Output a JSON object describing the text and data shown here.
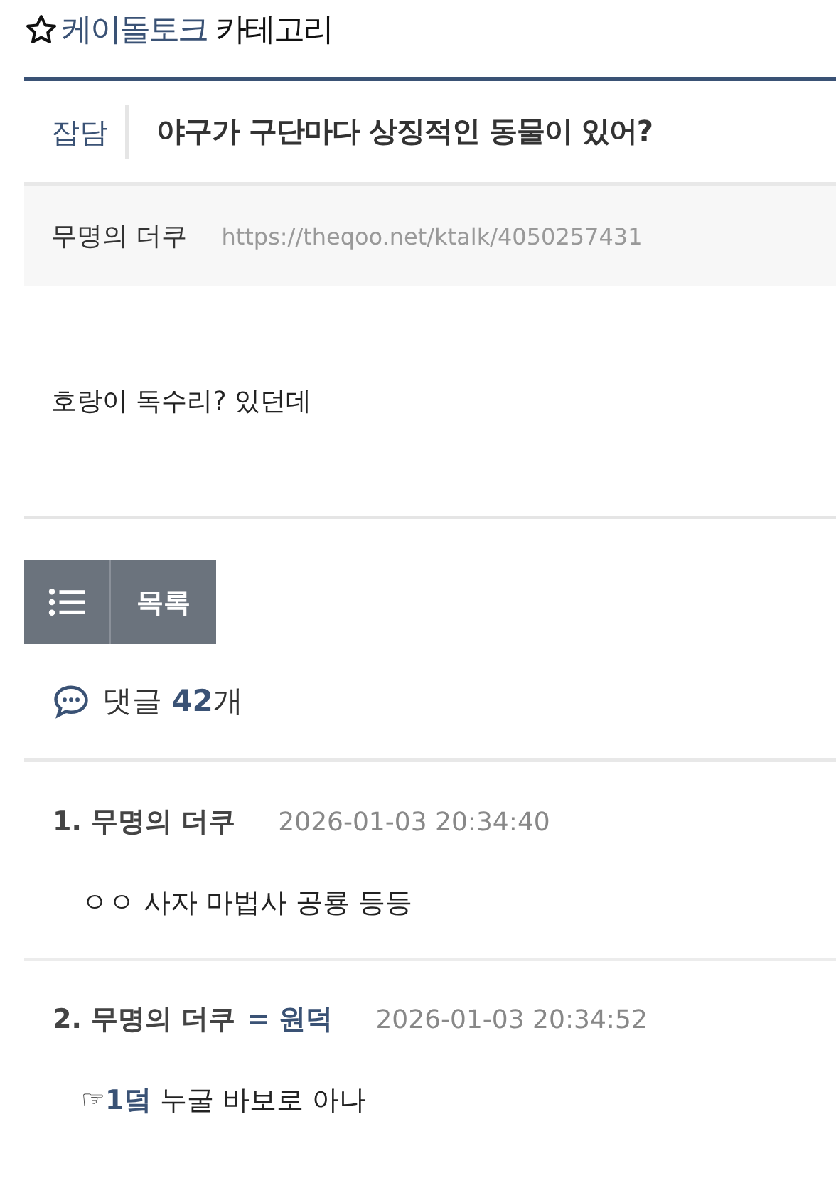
{
  "board": {
    "name": "케이돌토크",
    "suffix": "카테고리",
    "favorited": false
  },
  "post": {
    "category": "잡담",
    "title": "야구가 구단마다 상징적인 동물이 있어?",
    "author": "무명의 더쿠",
    "url": "https://theqoo.net/ktalk/4050257431",
    "body": "호랑이 독수리? 있던데"
  },
  "list_button": {
    "label": "목록"
  },
  "comments_header": {
    "label": "댓글",
    "count": "42",
    "unit": "개"
  },
  "comments": [
    {
      "number": "1.",
      "author": "무명의 더쿠",
      "date": "2026-01-03 20:34:40",
      "body": "ㅇㅇ 사자 마법사 공룡 등등"
    },
    {
      "number": "2.",
      "author": "무명의 더쿠",
      "op_tag": "= 원덕",
      "date": "2026-01-03 20:34:52",
      "body": "☞**1덬** 누굴 바보로 아나"
    }
  ]
}
